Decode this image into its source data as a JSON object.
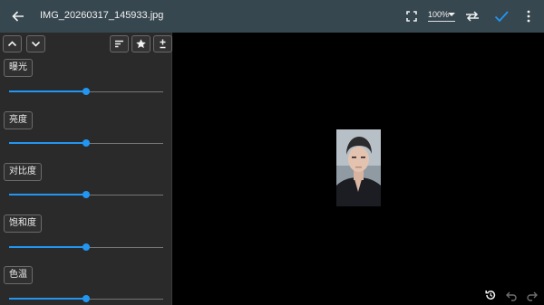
{
  "header": {
    "back_icon": "arrow-left-icon",
    "title": "IMG_20260317_145933.jpg",
    "zoom": "100%",
    "fullscreen_icon": "fullscreen-icon",
    "swap_icon": "swap-horizontal-icon",
    "confirm_icon": "check-icon",
    "more_icon": "more-vert-icon"
  },
  "panel": {
    "toolbar": {
      "up_icon": "chevron-up-icon",
      "down_icon": "chevron-down-icon",
      "sort_icon": "sort-icon",
      "star_icon": "star-icon",
      "plusminus_icon": "plus-minus-icon"
    },
    "adjustments": [
      {
        "label": "曝光",
        "value": 0.5
      },
      {
        "label": "亮度",
        "value": 0.5
      },
      {
        "label": "对比度",
        "value": 0.5
      },
      {
        "label": "饱和度",
        "value": 0.5
      },
      {
        "label": "色温",
        "value": 0.5
      }
    ]
  },
  "bottom": {
    "reset_icon": "history-icon",
    "undo_icon": "undo-icon",
    "redo_icon": "redo-icon"
  },
  "colors": {
    "topbar": "#37474f",
    "accent": "#2196f3",
    "panel": "#2a2a2a",
    "canvas": "#000000"
  }
}
